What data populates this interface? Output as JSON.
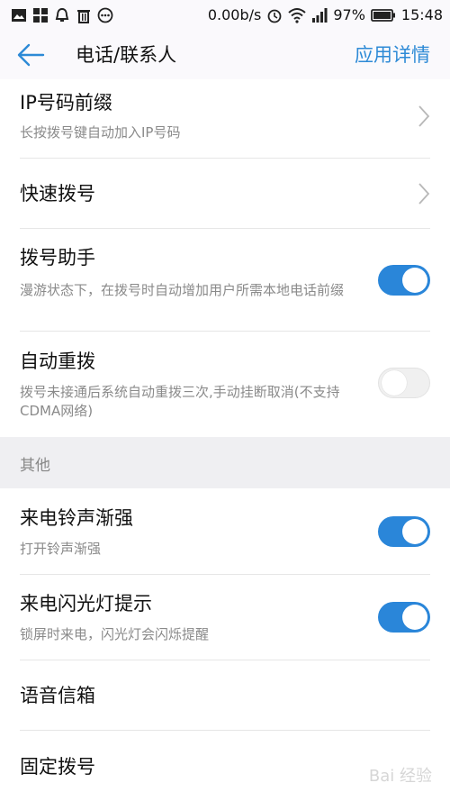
{
  "status_bar": {
    "left_icons": [
      "image-icon",
      "apps-grid-icon",
      "alarm-bell-icon",
      "trash-icon",
      "more-dots-icon"
    ],
    "net_speed": "0.00b/s",
    "battery_percent": "97%",
    "time": "15:48"
  },
  "app_bar": {
    "title": "电话/联系人",
    "action": "应用详情"
  },
  "settings": {
    "ip_prefix": {
      "title": "IP号码前缀",
      "subtitle": "长按拨号键自动加入IP号码"
    },
    "speed_dial": {
      "title": "快速拨号"
    },
    "dial_assistant": {
      "title": "拨号助手",
      "subtitle": "漫游状态下，在拨号时自动增加用户所需本地电话前缀",
      "enabled": true
    },
    "auto_redial": {
      "title": "自动重拨",
      "subtitle": "拨号未接通后系统自动重拨三次,手动挂断取消(不支持CDMA网络)",
      "enabled": false
    }
  },
  "section_other": {
    "label": "其他"
  },
  "other": {
    "ringtone_crescendo": {
      "title": "来电铃声渐强",
      "subtitle": "打开铃声渐强",
      "enabled": true
    },
    "flash_alert": {
      "title": "来电闪光灯提示",
      "subtitle": "锁屏时来电，闪光灯会闪烁提醒",
      "enabled": true
    },
    "voicemail": {
      "title": "语音信箱"
    },
    "fixed_dialing": {
      "title": "固定拨号"
    }
  },
  "watermark": "Bai 经验",
  "colors": {
    "accent": "#2a86d9",
    "section_bg": "#efeff2"
  }
}
